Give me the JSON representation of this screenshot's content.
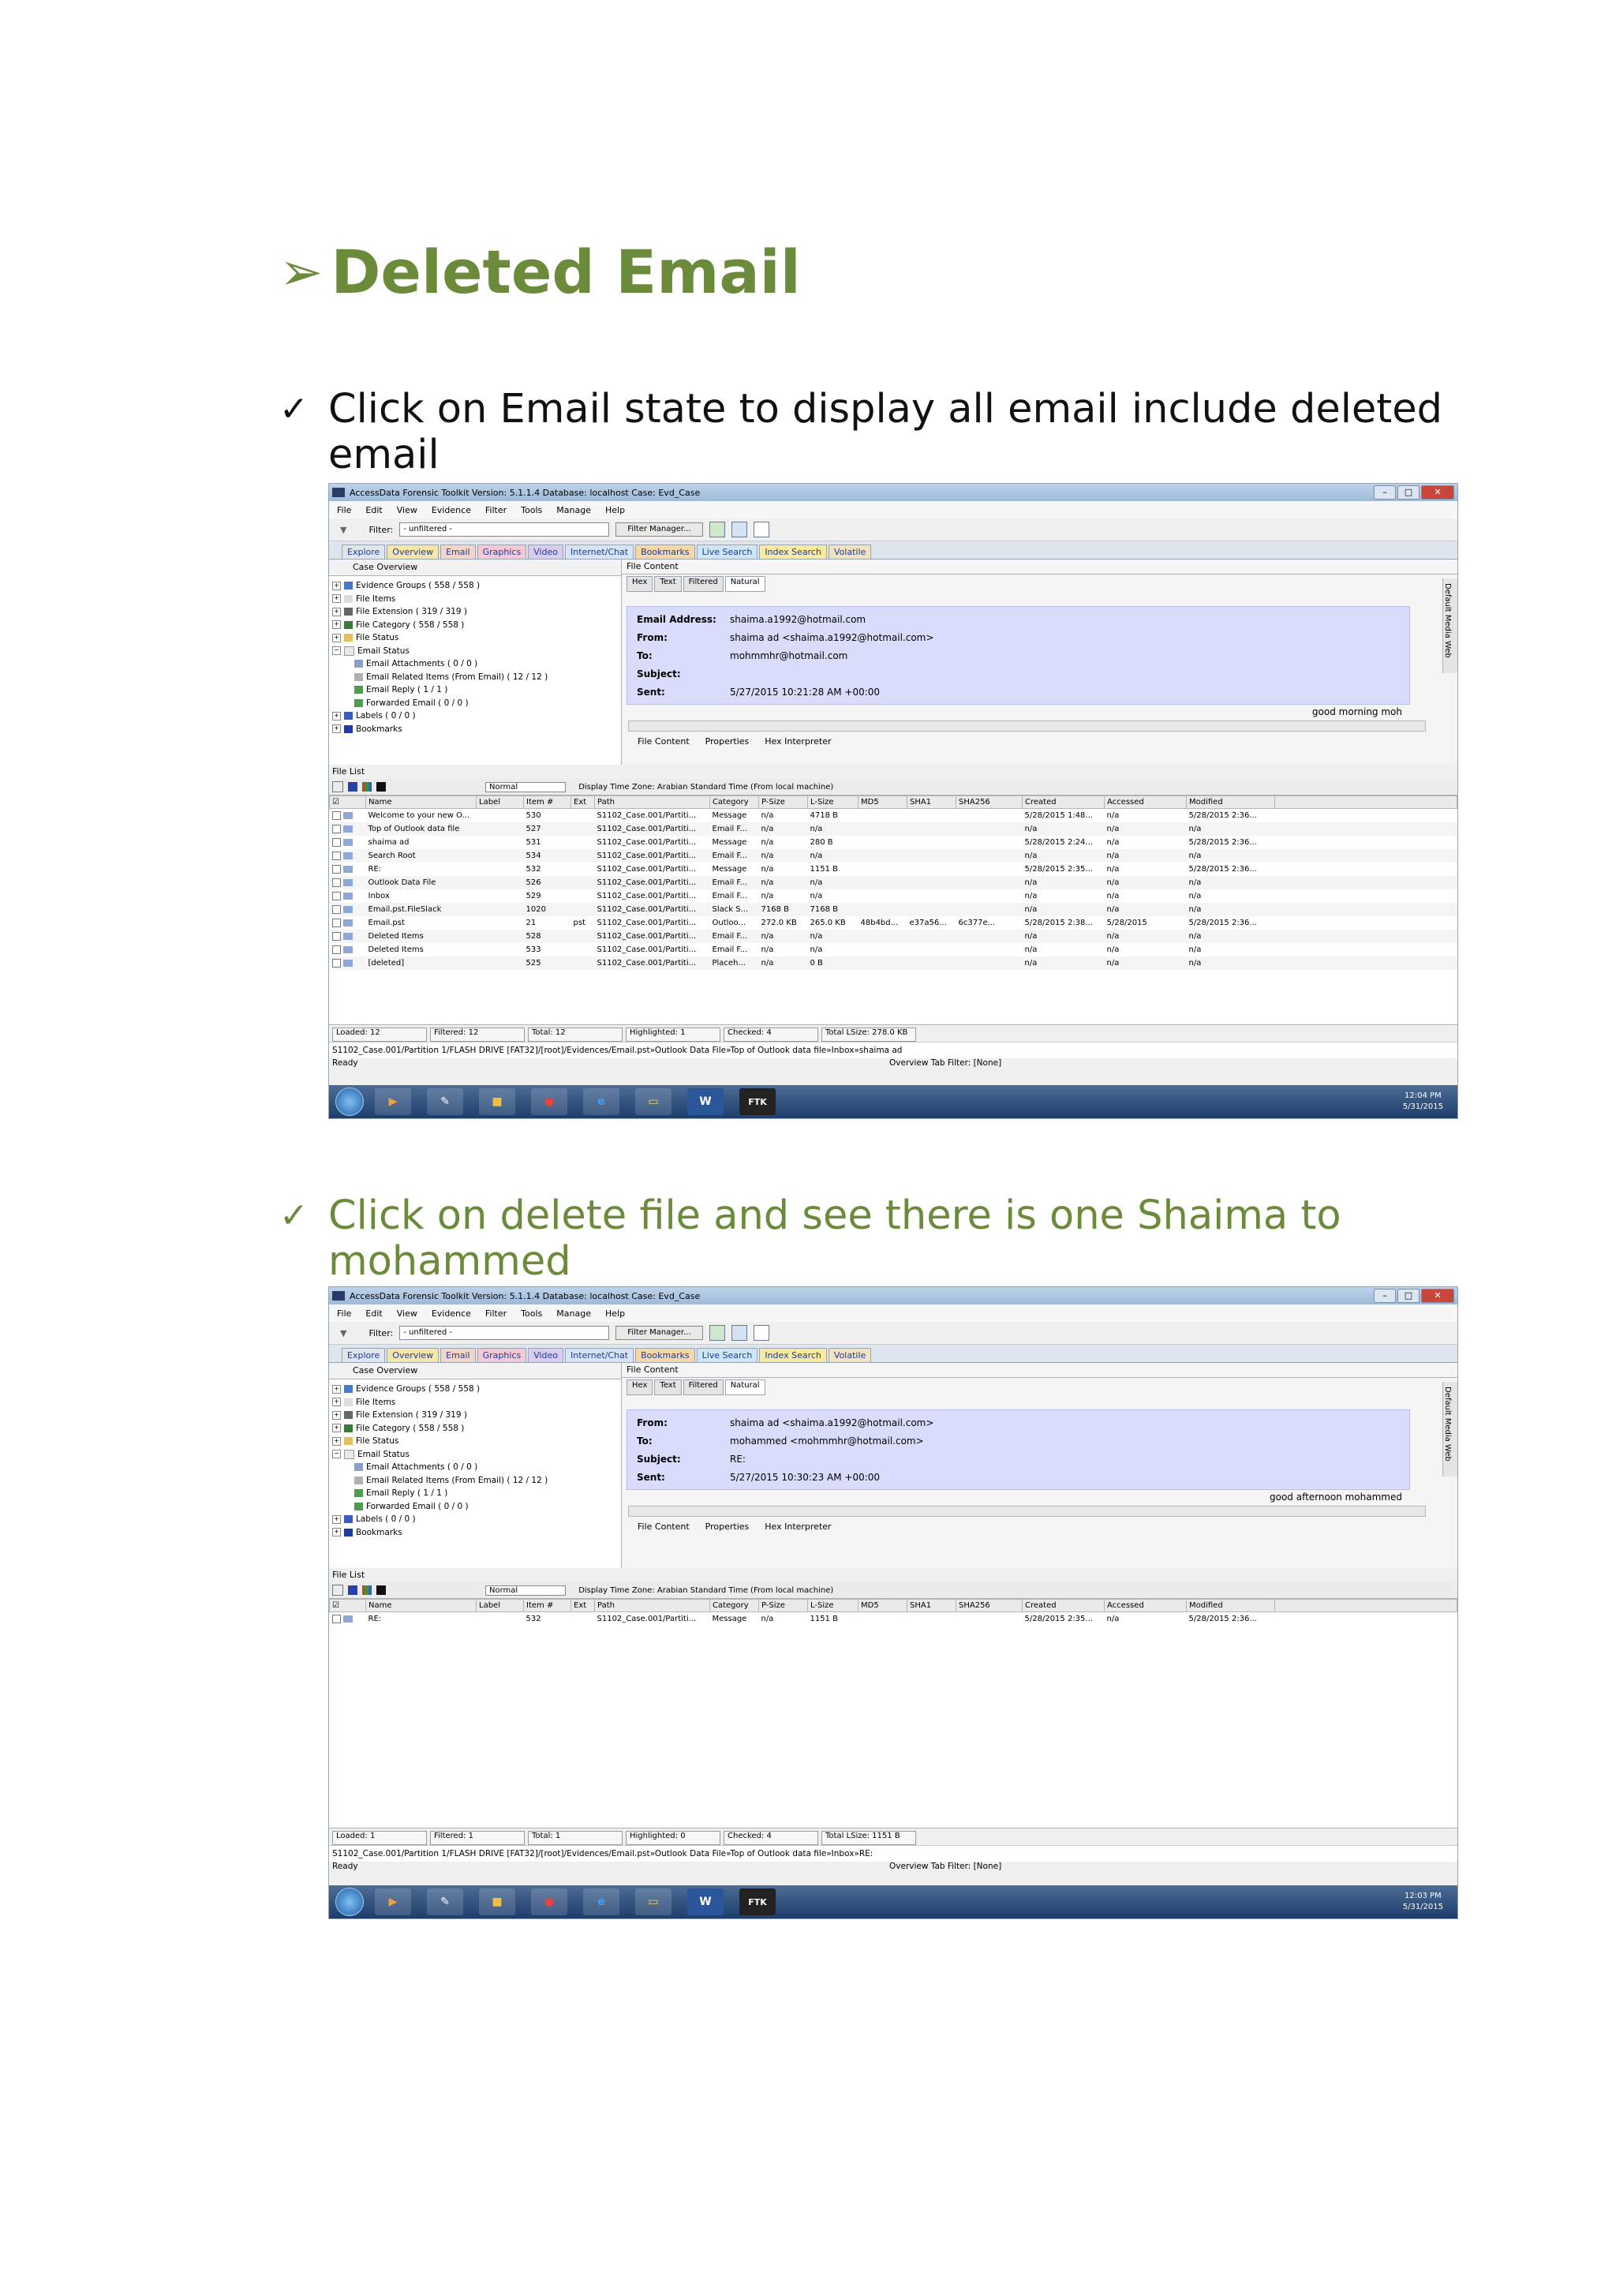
{
  "heading": "Deleted Email",
  "bullets": [
    {
      "line1": "Click on Email state to display all email include deleted",
      "line2": "email"
    },
    {
      "line1": "Click on delete file and see there is one Shaima to",
      "line2": "mohammed"
    }
  ],
  "app": {
    "title": "AccessData Forensic Toolkit Version: 5.1.1.4 Database: localhost Case: Evd_Case",
    "menu": [
      "File",
      "Edit",
      "View",
      "Evidence",
      "Filter",
      "Tools",
      "Manage",
      "Help"
    ],
    "filter_label": "Filter:",
    "filter_value": "- unfiltered -",
    "filter_manager": "Filter Manager...",
    "tabs": [
      "Explore",
      "Overview",
      "Email",
      "Graphics",
      "Video",
      "Internet/Chat",
      "Bookmarks",
      "Live Search",
      "Index Search",
      "Volatile"
    ],
    "case_overview": "Case Overview",
    "tree": [
      "Evidence Groups ( 558 / 558 )",
      "File Items",
      "File Extension ( 319 / 319 )",
      "File Category ( 558 / 558 )",
      "File Status",
      "Email Status",
      "Email Attachments ( 0 / 0 )",
      "Email Related Items (From Email) ( 12 / 12 )",
      "Email Reply ( 1 / 1 )",
      "Forwarded Email ( 0 / 0 )",
      "Labels ( 0 / 0 )",
      "Bookmarks"
    ],
    "file_content": "File Content",
    "view_tabs": [
      "Hex",
      "Text",
      "Filtered",
      "Natural"
    ],
    "side_tab": "Default Media Web",
    "bottom_tabs": [
      "File Content",
      "Properties",
      "Hex Interpreter"
    ],
    "file_list": "File List",
    "view_mode": "Normal",
    "time_zone": "Display Time Zone: Arabian Standard Time  (From local machine)",
    "columns": [
      "Name",
      "Label",
      "Item #",
      "Ext",
      "Path",
      "Category",
      "P-Size",
      "L-Size",
      "MD5",
      "SHA1",
      "SHA256",
      "Created",
      "Accessed",
      "Modified"
    ],
    "status_ready": "Ready",
    "tab_filter": "Overview Tab Filter: [None]"
  },
  "screenshot1": {
    "email": [
      {
        "k": "Email Address:",
        "v": "shaima.a1992@hotmail.com"
      },
      {
        "k": "From:",
        "v": "shaima ad <shaima.a1992@hotmail.com>"
      },
      {
        "k": "To:",
        "v": "mohmmhr@hotmail.com"
      },
      {
        "k": "Subject:",
        "v": ""
      },
      {
        "k": "Sent:",
        "v": "5/27/2015 10:21:28 AM +00:00"
      }
    ],
    "body": "good morning moh",
    "rows": [
      [
        "Welcome to your new O...",
        "",
        "530",
        "",
        "S1102_Case.001/Partiti...",
        "Message",
        "n/a",
        "4718 B",
        "",
        "",
        "",
        "5/28/2015 1:48...",
        "n/a",
        "5/28/2015 2:36..."
      ],
      [
        "Top of Outlook data file",
        "",
        "527",
        "",
        "S1102_Case.001/Partiti...",
        "Email F...",
        "n/a",
        "n/a",
        "",
        "",
        "",
        "n/a",
        "n/a",
        "n/a"
      ],
      [
        "shaima ad",
        "",
        "531",
        "",
        "S1102_Case.001/Partiti...",
        "Message",
        "n/a",
        "280 B",
        "",
        "",
        "",
        "5/28/2015 2:24...",
        "n/a",
        "5/28/2015 2:36..."
      ],
      [
        "Search Root",
        "",
        "534",
        "",
        "S1102_Case.001/Partiti...",
        "Email F...",
        "n/a",
        "n/a",
        "",
        "",
        "",
        "n/a",
        "n/a",
        "n/a"
      ],
      [
        "RE:",
        "",
        "532",
        "",
        "S1102_Case.001/Partiti...",
        "Message",
        "n/a",
        "1151 B",
        "",
        "",
        "",
        "5/28/2015 2:35...",
        "n/a",
        "5/28/2015 2:36..."
      ],
      [
        "Outlook Data File",
        "",
        "526",
        "",
        "S1102_Case.001/Partiti...",
        "Email F...",
        "n/a",
        "n/a",
        "",
        "",
        "",
        "n/a",
        "n/a",
        "n/a"
      ],
      [
        "Inbox",
        "",
        "529",
        "",
        "S1102_Case.001/Partiti...",
        "Email F...",
        "n/a",
        "n/a",
        "",
        "",
        "",
        "n/a",
        "n/a",
        "n/a"
      ],
      [
        "Email.pst.FileSlack",
        "",
        "1020",
        "",
        "S1102_Case.001/Partiti...",
        "Slack S...",
        "7168 B",
        "7168 B",
        "",
        "",
        "",
        "n/a",
        "n/a",
        "n/a"
      ],
      [
        "Email.pst",
        "",
        "21",
        "pst",
        "S1102_Case.001/Partiti...",
        "Outloo...",
        "272.0 KB",
        "265.0 KB",
        "48b4bd...",
        "e37a56...",
        "6c377e...",
        "5/28/2015 2:38...",
        "5/28/2015",
        "5/28/2015 2:36..."
      ],
      [
        "Deleted Items",
        "",
        "528",
        "",
        "S1102_Case.001/Partiti...",
        "Email F...",
        "n/a",
        "n/a",
        "",
        "",
        "",
        "n/a",
        "n/a",
        "n/a"
      ],
      [
        "Deleted Items",
        "",
        "533",
        "",
        "S1102_Case.001/Partiti...",
        "Email F...",
        "n/a",
        "n/a",
        "",
        "",
        "",
        "n/a",
        "n/a",
        "n/a"
      ],
      [
        "[deleted]",
        "",
        "525",
        "",
        "S1102_Case.001/Partiti...",
        "Placeh...",
        "n/a",
        "0 B",
        "",
        "",
        "",
        "n/a",
        "n/a",
        "n/a"
      ]
    ],
    "counts": [
      "Loaded: 12",
      "Filtered: 12",
      "Total: 12",
      "Highlighted: 1",
      "Checked: 4",
      "Total LSize: 278.0 KB"
    ],
    "path": "S1102_Case.001/Partition 1/FLASH DRIVE [FAT32]/[root]/Evidences/Email.pst»Outlook Data File»Top of Outlook data file»Inbox»shaima ad",
    "time": "12:04 PM",
    "date": "5/31/2015"
  },
  "screenshot2": {
    "email": [
      {
        "k": "From:",
        "v": "shaima ad <shaima.a1992@hotmail.com>"
      },
      {
        "k": "To:",
        "v": "mohammed <mohmmhr@hotmail.com>"
      },
      {
        "k": "Subject:",
        "v": "RE:"
      },
      {
        "k": "Sent:",
        "v": "5/27/2015 10:30:23 AM +00:00"
      }
    ],
    "body": "good afternoon mohammed",
    "rows": [
      [
        "RE:",
        "",
        "532",
        "",
        "S1102_Case.001/Partiti...",
        "Message",
        "n/a",
        "1151 B",
        "",
        "",
        "",
        "5/28/2015 2:35...",
        "n/a",
        "5/28/2015 2:36..."
      ]
    ],
    "counts": [
      "Loaded: 1",
      "Filtered: 1",
      "Total: 1",
      "Highlighted: 0",
      "Checked: 4",
      "Total LSize: 1151 B"
    ],
    "path": "S1102_Case.001/Partition 1/FLASH DRIVE [FAT32]/[root]/Evidences/Email.pst»Outlook Data File»Top of Outlook data file»Inbox»RE:",
    "time": "12:03 PM",
    "date": "5/31/2015"
  }
}
